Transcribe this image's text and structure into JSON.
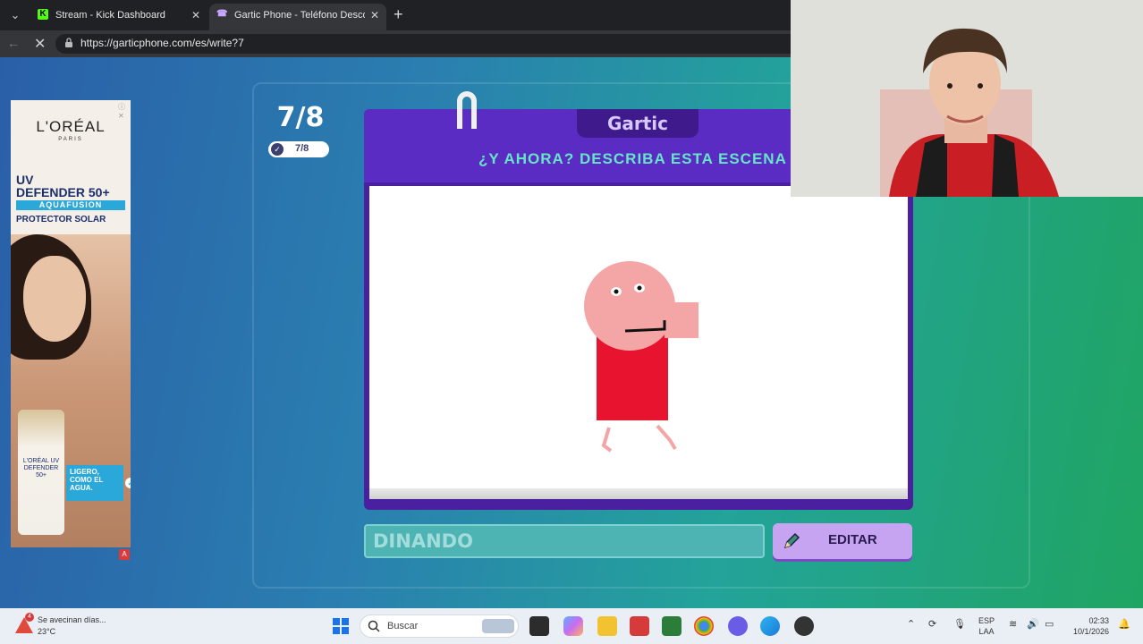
{
  "browser": {
    "tabs": [
      {
        "title": "Stream - Kick Dashboard",
        "favicon": "K"
      },
      {
        "title": "Gartic Phone - Teléfono Descomp",
        "favicon": "☎"
      }
    ],
    "url": "https://garticphone.com/es/write?7"
  },
  "ad": {
    "brand": "L'ORÉAL",
    "brand_sub": "PARIS",
    "product_line1": "UV",
    "product_line2": "DEFENDER 50+",
    "aquafusion": "AQUAFUSION",
    "protector": "PROTECTOR SOLAR",
    "bottle_text": "L'ORÉAL UV DEFENDER 50+",
    "badge": "LIGERO, COMO EL AGUA."
  },
  "game": {
    "counter": "7/8",
    "badge_count": "7/8",
    "logo": "Gartic",
    "prompt": "¿Y AHORA? DESCRIBA ESTA ESCENA",
    "answer_value": "DINANDO",
    "edit_label": "EDITAR"
  },
  "taskbar": {
    "weather_alert_count": "4",
    "weather_title": "Se avecinan días...",
    "temperature": "23°C",
    "search_label": "Buscar",
    "lang_line1": "ESP",
    "lang_line2": "LAA",
    "time": "02:33",
    "date": "10/1/2026"
  }
}
